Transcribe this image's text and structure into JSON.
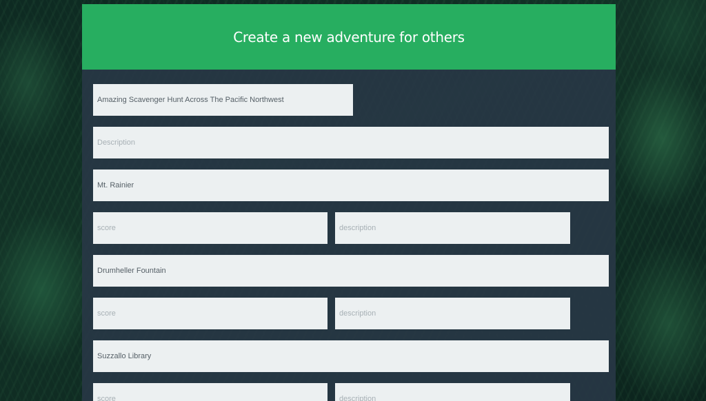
{
  "header": {
    "title": "Create a new adventure for others"
  },
  "adventure": {
    "title_value": "Amazing Scavenger Hunt Across The Pacific Northwest",
    "description_placeholder": "Description"
  },
  "locations": [
    {
      "name_value": "Mt. Rainier",
      "score_placeholder": "score",
      "description_placeholder": "description"
    },
    {
      "name_value": "Drumheller Fountain",
      "score_placeholder": "score",
      "description_placeholder": "description"
    },
    {
      "name_value": "Suzzallo Library",
      "score_placeholder": "score",
      "description_placeholder": "description"
    }
  ],
  "colors": {
    "header_green": "#27ae60",
    "panel": "#28374a",
    "field_bg": "#ecf0f1"
  }
}
